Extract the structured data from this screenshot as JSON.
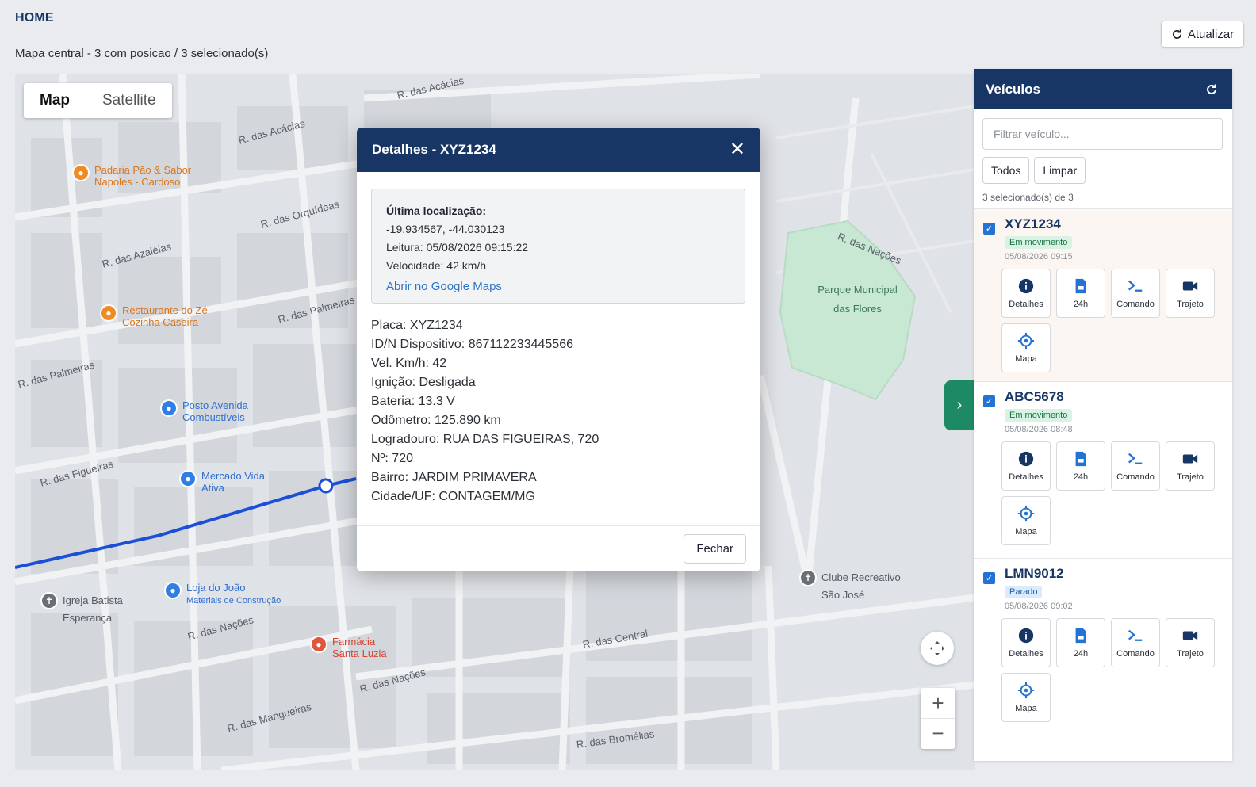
{
  "header": {
    "breadcrumb": "HOME",
    "subtitle": "Mapa central - 3 com posicao / 3 selecionado(s)",
    "refresh_label": "Atualizar"
  },
  "map": {
    "type_buttons": [
      "Map",
      "Satellite"
    ],
    "active_type": "Map",
    "park_label": "Parque Municipal das Flores",
    "streets": [
      "R. das Acácias",
      "R. das Acácias",
      "R. das Orquídeas",
      "R. das Azaléias",
      "R. das Palmeiras",
      "R. das Palmeiras",
      "R. das Figueiras",
      "R. das Nações",
      "R. das Nações",
      "R. das Mangueiras",
      "R. das Central",
      "R. das Bromélias",
      "R. das Nações"
    ],
    "pois": [
      {
        "name": "Padaria Pão & Sabor",
        "sub": "Napoles - Cardoso",
        "color": "#f08a24",
        "icon": "restaurant-icon"
      },
      {
        "name": "Restaurante do Zé",
        "sub": "Cozinha Caseira",
        "color": "#f08a24",
        "icon": "restaurant-icon"
      },
      {
        "name": "Posto Avenida",
        "sub": "Combustíveis",
        "color": "#2f7ee6",
        "icon": "shopping-icon"
      },
      {
        "name": "Mercado Vida",
        "sub": "Ativa",
        "color": "#2f7ee6",
        "icon": "shopping-icon"
      },
      {
        "name": "Loja do João",
        "sub": "Materiais de Construção",
        "color": "#2f7ee6",
        "icon": "store-icon"
      },
      {
        "name": "Igreja Batista",
        "sub": "Esperança",
        "color": "#6b7077",
        "icon": "church-icon"
      },
      {
        "name": "Farmácia",
        "sub": "Santa Luzia",
        "color": "#e2553d",
        "icon": "pharmacy-icon"
      },
      {
        "name": "Clube Recreativo",
        "sub": "São José",
        "color": "#6b7077",
        "icon": "church-icon"
      }
    ]
  },
  "modal": {
    "title": "Detalhes - XYZ1234",
    "location_label": "Última localização:",
    "coords": "-19.934567, -44.030123",
    "reading": "Leitura: 05/08/2026 09:15:22",
    "speed": "Velocidade: 42 km/h",
    "maps_link": "Abrir no Google Maps",
    "fields": [
      "Placa: XYZ1234",
      "ID/N Dispositivo: 867112233445566",
      "Vel. Km/h: 42",
      "Ignição: Desligada",
      "Bateria: 13.3 V",
      "Odômetro: 125.890 km",
      "Logradouro: RUA DAS FIGUEIRAS, 720",
      "Nº: 720",
      "Bairro: JARDIM PRIMAVERA",
      "Cidade/UF: CONTAGEM/MG"
    ],
    "close_label": "Fechar"
  },
  "panel": {
    "title": "Veículos",
    "filter_placeholder": "Filtrar veículo...",
    "btn_all": "Todos",
    "btn_clear": "Limpar",
    "count": "3 selecionado(s) de 3",
    "action_labels": [
      "Detalhes",
      "24h",
      "Comando",
      "Trajeto",
      "Mapa"
    ],
    "vehicles": [
      {
        "plate": "XYZ1234",
        "status": "Em movimento",
        "time": "05/08/2026 09:15",
        "checked": true
      },
      {
        "plate": "ABC5678",
        "status": "Em movimento",
        "time": "05/08/2026 08:48",
        "checked": true
      },
      {
        "plate": "LMN9012",
        "status": "Parado",
        "time": "05/08/2026 09:02",
        "checked": true
      }
    ]
  },
  "colors": {
    "primary": "#183665",
    "accent": "#1e8a65",
    "route": "#1a4fd6",
    "moving_badge": "#d8f3e4",
    "stopped_badge": "#dcebfb"
  }
}
